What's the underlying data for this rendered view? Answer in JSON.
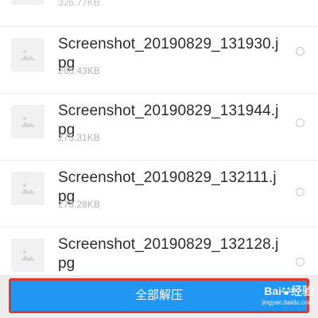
{
  "file_list": {
    "partial_item": {
      "size": "326.77KB"
    },
    "items": [
      {
        "name": "Screenshot_20190829_131930.jpg",
        "size": "266.43KB"
      },
      {
        "name": "Screenshot_20190829_131944.jpg",
        "size": "275.31KB"
      },
      {
        "name": "Screenshot_20190829_132111.jpg",
        "size": "273.28KB"
      },
      {
        "name": "Screenshot_20190829_132128.jpg",
        "size": ""
      }
    ]
  },
  "footer": {
    "extract_all_label": "全部解压"
  },
  "watermark": {
    "brand_left": "Bai",
    "brand_right": "经验",
    "url": "jingyan.baidu.com"
  },
  "icons": {
    "thumbnail": "image-placeholder-icon",
    "paw": "baidu-paw-icon"
  },
  "colors": {
    "accent": "#2196f3",
    "highlight_border": "#d93a30",
    "text_primary": "#2b2b2b",
    "text_secondary": "#b3b3b3"
  }
}
